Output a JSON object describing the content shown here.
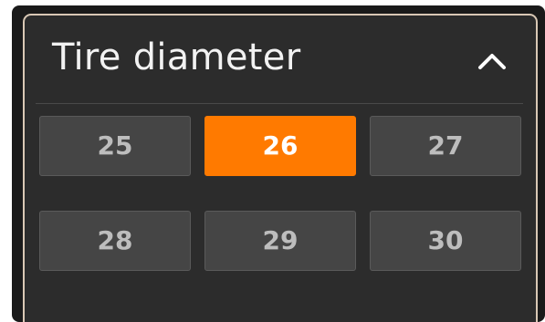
{
  "panel": {
    "title": "Tire diameter",
    "collapse_icon": "chevron-up-icon"
  },
  "options": [
    {
      "label": "25",
      "selected": false
    },
    {
      "label": "26",
      "selected": true
    },
    {
      "label": "27",
      "selected": false
    },
    {
      "label": "28",
      "selected": false
    },
    {
      "label": "29",
      "selected": false
    },
    {
      "label": "30",
      "selected": false
    }
  ],
  "colors": {
    "accent": "#ff7a00",
    "panel_bg": "#2c2c2c",
    "option_bg": "#454545",
    "border": "#d9c8b5"
  }
}
